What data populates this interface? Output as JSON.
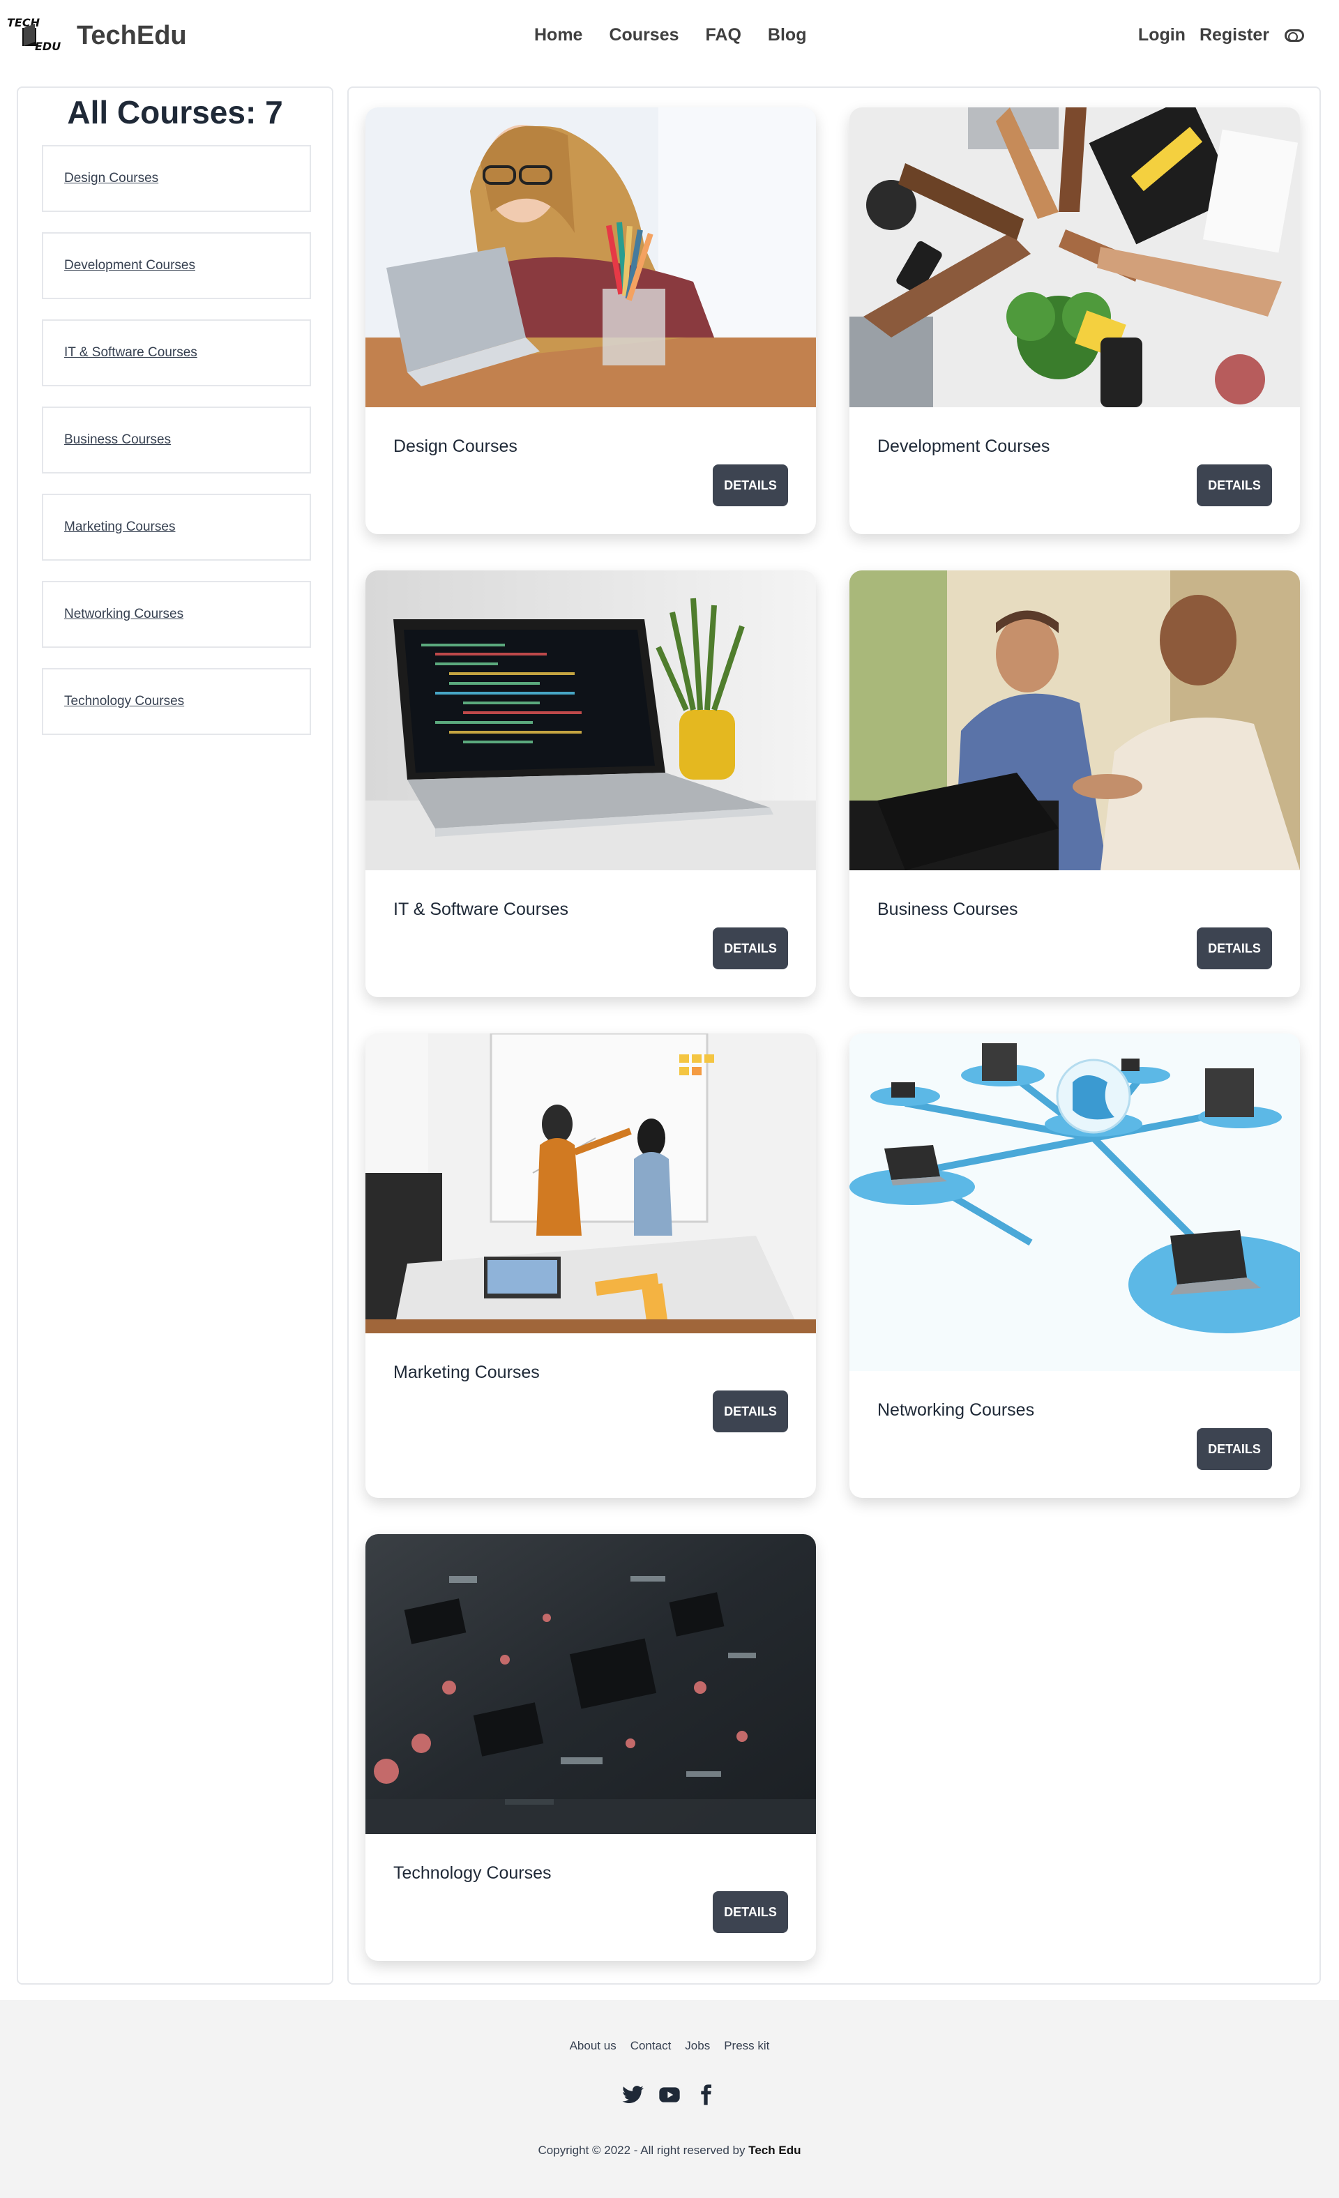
{
  "brand": {
    "logo_line1": "TECH",
    "logo_line2": "EDU",
    "name": "TechEdu"
  },
  "nav": {
    "home": "Home",
    "courses": "Courses",
    "faq": "FAQ",
    "blog": "Blog",
    "login": "Login",
    "register": "Register"
  },
  "sidebar": {
    "title": "All Courses: 7",
    "items": [
      {
        "label": "Design Courses"
      },
      {
        "label": "Development Courses"
      },
      {
        "label": "IT & Software Courses"
      },
      {
        "label": "Business Courses"
      },
      {
        "label": "Marketing Courses"
      },
      {
        "label": "Networking Courses"
      },
      {
        "label": "Technology Courses"
      }
    ]
  },
  "cards": [
    {
      "title": "Design Courses",
      "button": "Details"
    },
    {
      "title": "Development Courses",
      "button": "Details"
    },
    {
      "title": "IT & Software Courses",
      "button": "Details"
    },
    {
      "title": "Business Courses",
      "button": "Details"
    },
    {
      "title": "Marketing Courses",
      "button": "Details"
    },
    {
      "title": "Networking Courses",
      "button": "Details"
    },
    {
      "title": "Technology Courses",
      "button": "Details"
    }
  ],
  "footer": {
    "links": [
      "About us",
      "Contact",
      "Jobs",
      "Press kit"
    ],
    "socials": [
      "twitter-icon",
      "youtube-icon",
      "facebook-icon"
    ],
    "copyright_prefix": "Copyright © 2022 - All right reserved by",
    "copyright_brand": "Tech Edu"
  },
  "colors": {
    "button": "#3d4451",
    "border": "#e5e7eb",
    "footer_bg": "#f3f3f3",
    "text": "#1f2937"
  }
}
